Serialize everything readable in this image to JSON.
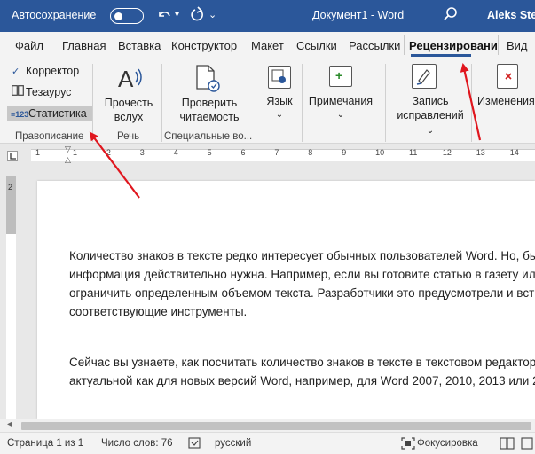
{
  "titlebar": {
    "autosave_label": "Автосохранение",
    "document_title": "Документ1 - Word",
    "user_name": "Aleks Step"
  },
  "tabs": [
    "Файл",
    "Главная",
    "Вставка",
    "Конструктор",
    "Макет",
    "Ссылки",
    "Рассылки",
    "Рецензировани",
    "Вид"
  ],
  "ribbon": {
    "proofing": {
      "corrector": "Корректор",
      "thesaurus": "Тезаурус",
      "statistics": "Статистика",
      "group_label": "Правописание"
    },
    "speech": {
      "read_aloud_line1": "Прочесть",
      "read_aloud_line2": "вслух",
      "group_label": "Речь"
    },
    "accessibility": {
      "check_line1": "Проверить",
      "check_line2": "читаемость",
      "group_label": "Специальные во..."
    },
    "language": {
      "label": "Язык"
    },
    "comments": {
      "label": "Примечания"
    },
    "tracking": {
      "line1": "Запись",
      "line2": "исправлений"
    },
    "changes": {
      "label": "Изменения"
    }
  },
  "ruler": {
    "numbers": [
      "1",
      "1",
      "2",
      "3",
      "4",
      "5",
      "6",
      "7",
      "8",
      "9",
      "10",
      "11",
      "12",
      "13",
      "14"
    ]
  },
  "vruler_number": "2",
  "document": {
    "paragraph1": "Количество знаков в тексте редко интересует обычных пользователей Word. Но, бы\nинформация действительно нужна. Например, если вы готовите статью в газету или\nограничить определенным объемом текста. Разработчики это предусмотрели и вст\nсоответствующие инструменты.",
    "paragraph2": "Сейчас вы узнаете, как посчитать количество знаков в тексте в текстовом редакторе\nактуальной как для новых версий Word, например, для Word 2007, 2010, 2013 или 2"
  },
  "statusbar": {
    "page": "Страница 1 из 1",
    "words": "Число слов: 76",
    "language": "русский",
    "focus": "Фокусировка"
  },
  "colors": {
    "titlebar_bg": "#2b579a",
    "annotation_arrow": "#e0161e"
  }
}
